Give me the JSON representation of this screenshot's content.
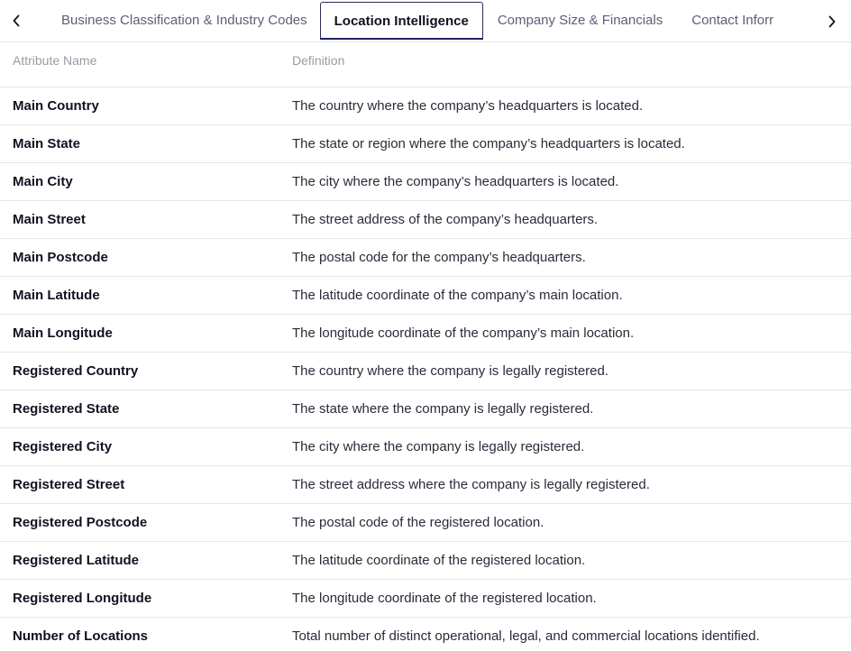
{
  "tabs": {
    "items": [
      {
        "label": "Business Classification & Industry Codes",
        "active": false
      },
      {
        "label": "Location Intelligence",
        "active": true
      },
      {
        "label": "Company Size & Financials",
        "active": false
      },
      {
        "label": "Contact Inforr",
        "active": false
      }
    ],
    "prev_icon": "chevron-left-icon",
    "next_icon": "chevron-right-icon"
  },
  "table": {
    "headers": {
      "name": "Attribute Name",
      "definition": "Definition"
    },
    "rows": [
      {
        "name": "Main Country",
        "definition": "The country where the company’s headquarters is located."
      },
      {
        "name": "Main State",
        "definition": "The state or region where the company’s headquarters is located."
      },
      {
        "name": "Main City",
        "definition": "The city where the company’s headquarters is located."
      },
      {
        "name": "Main Street",
        "definition": "The street address of the company’s headquarters."
      },
      {
        "name": "Main Postcode",
        "definition": "The postal code for the company’s headquarters."
      },
      {
        "name": "Main Latitude",
        "definition": "The latitude coordinate of the company’s main location."
      },
      {
        "name": "Main Longitude",
        "definition": "The longitude coordinate of the company’s main location."
      },
      {
        "name": "Registered Country",
        "definition": "The country where the company is legally registered."
      },
      {
        "name": "Registered State",
        "definition": "The state where the company is legally registered."
      },
      {
        "name": "Registered City",
        "definition": "The city where the company is legally registered."
      },
      {
        "name": "Registered Street",
        "definition": "The street address where the company is legally registered."
      },
      {
        "name": "Registered Postcode",
        "definition": "The postal code of the registered location."
      },
      {
        "name": "Registered Latitude",
        "definition": "The latitude coordinate of the registered location."
      },
      {
        "name": "Registered Longitude",
        "definition": "The longitude coordinate of the registered location."
      },
      {
        "name": "Number of Locations",
        "definition": "Total number of distinct operational, legal, and commercial locations identified."
      }
    ]
  }
}
